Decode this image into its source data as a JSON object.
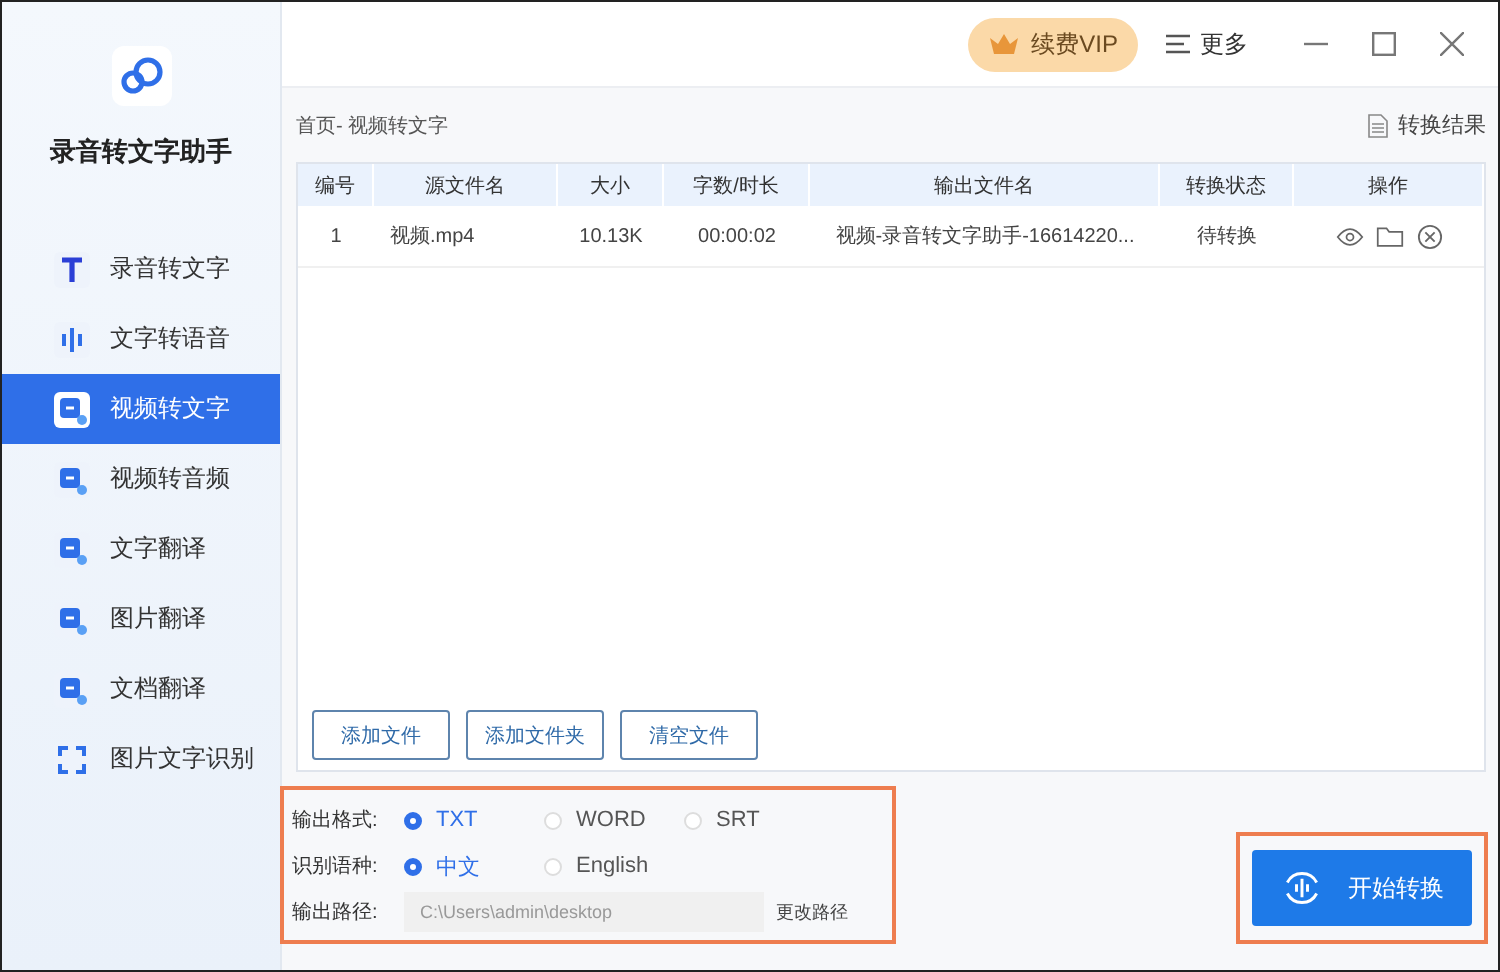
{
  "app": {
    "title": "录音转文字助手"
  },
  "sidebar": {
    "items": [
      {
        "label": "录音转文字",
        "selected": false
      },
      {
        "label": "文字转语音",
        "selected": false
      },
      {
        "label": "视频转文字",
        "selected": true
      },
      {
        "label": "视频转音频",
        "selected": false
      },
      {
        "label": "文字翻译",
        "selected": false
      },
      {
        "label": "图片翻译",
        "selected": false
      },
      {
        "label": "文档翻译",
        "selected": false
      },
      {
        "label": "图片文字识别",
        "selected": false
      }
    ]
  },
  "topbar": {
    "vip": "续费VIP",
    "more": "更多"
  },
  "breadcrumb": "首页- 视频转文字",
  "results_link": "转换结果",
  "table": {
    "columns": [
      "编号",
      "源文件名",
      "大小",
      "字数/时长",
      "输出文件名",
      "转换状态",
      "操作"
    ],
    "rows": [
      {
        "cells": [
          "1",
          "视频.mp4",
          "10.13K",
          "00:00:02",
          "视频-录音转文字助手-16614220...",
          "待转换"
        ]
      }
    ]
  },
  "file_buttons": [
    "添加文件",
    "添加文件夹",
    "清空文件"
  ],
  "options": {
    "format": {
      "label": "输出格式:",
      "choices": [
        {
          "label": "TXT",
          "selected": true
        },
        {
          "label": "WORD",
          "selected": false
        },
        {
          "label": "SRT",
          "selected": false
        }
      ]
    },
    "language": {
      "label": "识别语种:",
      "choices": [
        {
          "label": "中文",
          "selected": true
        },
        {
          "label": "English",
          "selected": false
        }
      ]
    },
    "path": {
      "label": "输出路径:",
      "value": "C:\\Users\\admin\\desktop",
      "change": "更改路径"
    }
  },
  "start_button": "开始转换"
}
